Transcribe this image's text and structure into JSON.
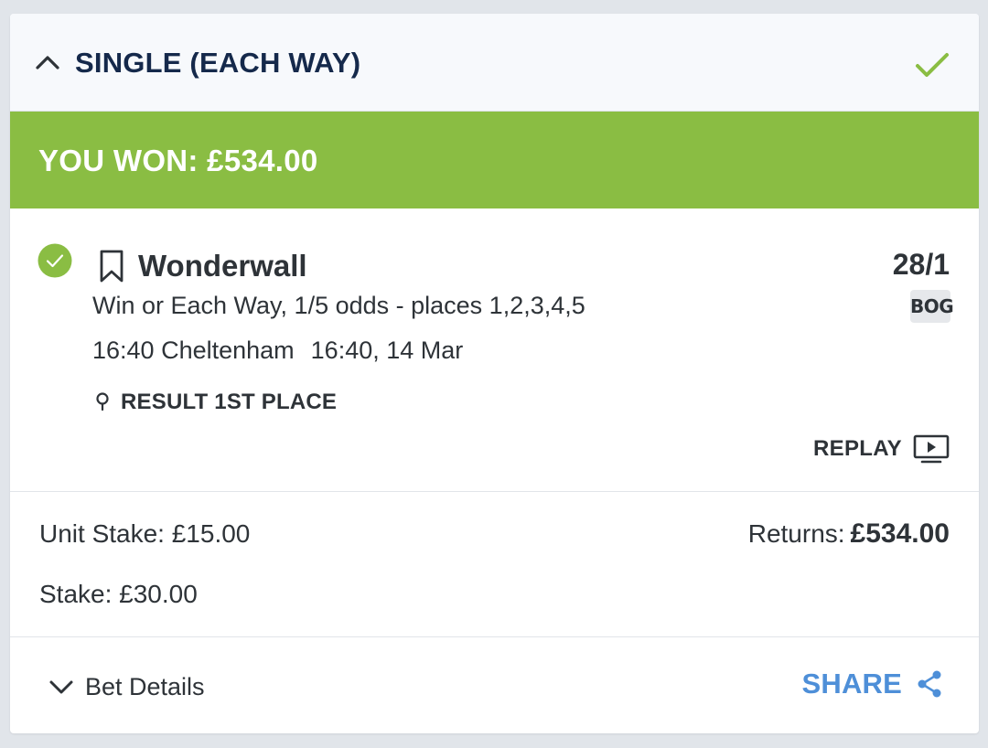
{
  "header": {
    "title": "SINGLE (EACH WAY)"
  },
  "banner": {
    "text": "YOU WON: £534.00"
  },
  "selection": {
    "name": "Wonderwall",
    "odds": "28/1",
    "badge": "BOG",
    "market": "Win or Each Way, 1/5 odds - places 1,2,3,4,5",
    "event_name": "16:40 Cheltenham",
    "event_time": "16:40, 14 Mar",
    "result": "RESULT 1ST PLACE",
    "replay_label": "REPLAY"
  },
  "summary": {
    "unit_stake": "Unit Stake: £15.00",
    "stake": "Stake: £30.00",
    "returns_label": "Returns:",
    "returns_value": "£534.00"
  },
  "footer": {
    "bet_details_label": "Bet Details",
    "share_label": "SHARE"
  },
  "colors": {
    "win_green": "#8abd43",
    "header_text": "#15294b",
    "share_blue": "#4e8fd8"
  },
  "icons": [
    "chevron-up-icon",
    "check-icon",
    "check-circle-icon",
    "bookmark-icon",
    "location-pin-icon",
    "tv-play-icon",
    "chevron-down-icon",
    "share-icon"
  ]
}
